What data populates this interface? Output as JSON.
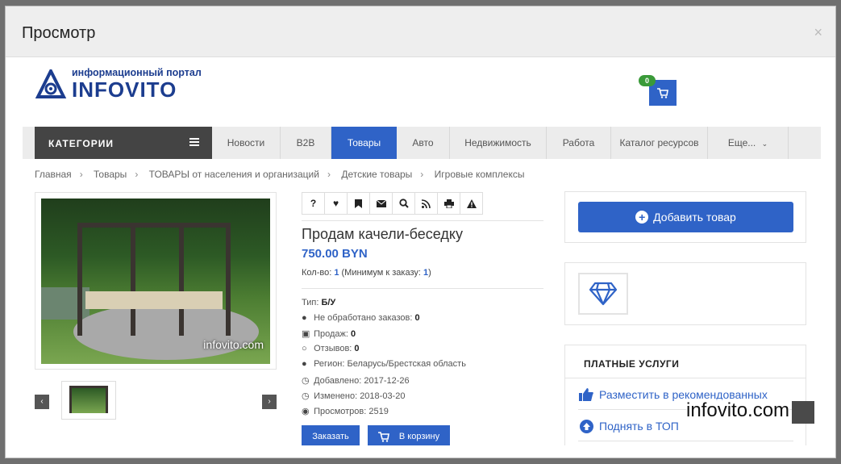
{
  "modal": {
    "title": "Просмотр",
    "close": "×"
  },
  "header": {
    "logo_sub": "информационный портал",
    "logo_main": "INFOVITO",
    "cart_count": "0"
  },
  "nav": {
    "categories_label": "КАТЕГОРИИ",
    "items": [
      "Новости",
      "B2B",
      "Товары",
      "Авто",
      "Недвижимость",
      "Работа",
      "Каталог ресурсов",
      "Еще..."
    ],
    "active": "Товары"
  },
  "breadcrumbs": [
    "Главная",
    "Товары",
    "ТОВАРЫ от населения и организаций",
    "Детские товары",
    "Игровые комплексы"
  ],
  "photo": {
    "watermark": "infovito.com"
  },
  "toolbar_icons": [
    "question-icon",
    "heart-icon",
    "bookmark-icon",
    "envelope-icon",
    "search-icon",
    "rss-icon",
    "print-icon",
    "warning-icon"
  ],
  "product": {
    "title": "Продам качели-беседку",
    "price": "750.00 BYN",
    "qty_label": "Кол-во:",
    "qty_value": "1",
    "min_label": "(Минимум к заказу:",
    "min_value": "1",
    "min_close": ")",
    "type_label": "Тип:",
    "type_value": "Б/У",
    "orders_label": "Не обработано заказов:",
    "orders_value": "0",
    "sales_label": "Продаж:",
    "sales_value": "0",
    "reviews_label": "Отзывов:",
    "reviews_value": "0",
    "region": "Регион: Беларусь/Брестская область",
    "added": "Добавлено: 2017-12-26",
    "changed": "Изменено: 2018-03-20",
    "views": "Просмотров: 2519",
    "order_button": "Заказать",
    "cart_button": "В корзину"
  },
  "sidebar": {
    "add_button": "Добавить товар",
    "paid_title": "ПЛАТНЫЕ УСЛУГИ",
    "paid_links": [
      "Разместить в рекомендованных",
      "Поднять в ТОП"
    ]
  },
  "page_watermark": "infovito.com",
  "colors": {
    "accent": "#2f63c7",
    "dark": "#444444",
    "badge": "#3a9a39"
  }
}
